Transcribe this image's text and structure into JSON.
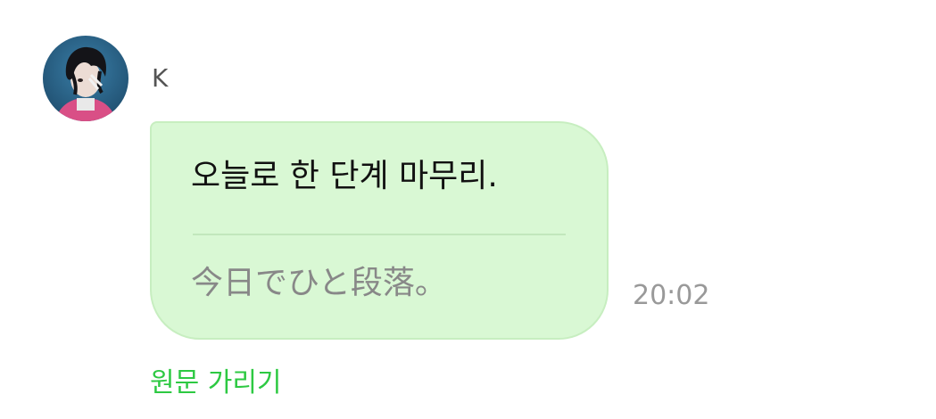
{
  "sender": {
    "name": "K",
    "avatar": "profile-photo"
  },
  "message": {
    "original_text": "오늘로 한 단계 마무리.",
    "translated_text": "今日でひと段落。",
    "time": "20:02"
  },
  "actions": {
    "hide_original_label": "원문 가리기"
  },
  "colors": {
    "bubble_background": "#d9f8d4",
    "accent_green": "#2dc942"
  }
}
